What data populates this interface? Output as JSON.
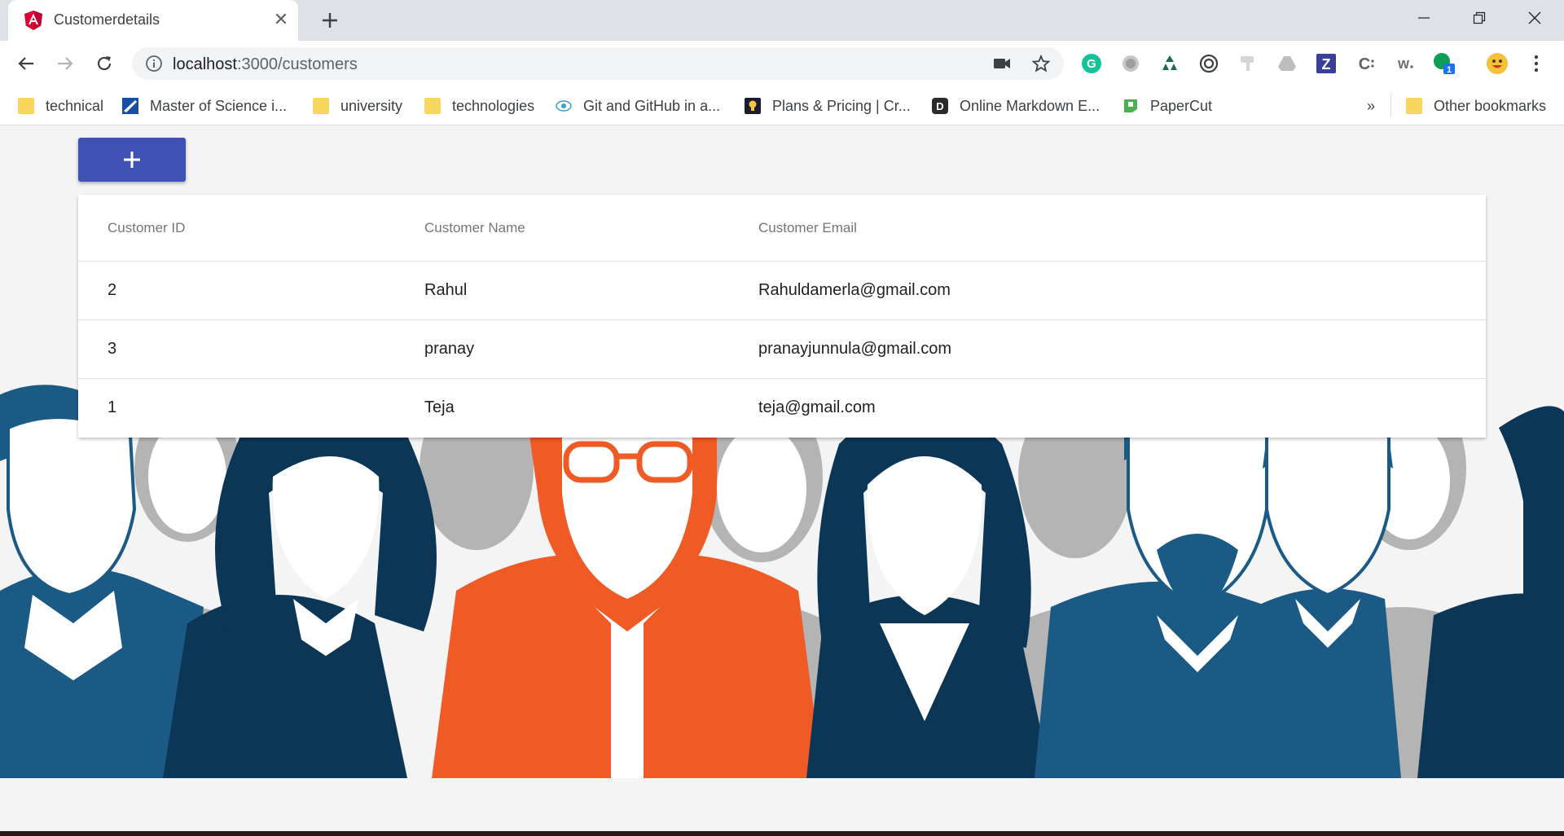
{
  "browser": {
    "tab_title": "Customerdetails",
    "url_host": "localhost",
    "url_path": ":3000/customers",
    "extension_badge": "1",
    "bookmarks": [
      {
        "label": "technical",
        "icon": "folder-icon"
      },
      {
        "label": "Master of Science i...",
        "icon": "university-logo-icon"
      },
      {
        "label": "university",
        "icon": "folder-icon"
      },
      {
        "label": "technologies",
        "icon": "folder-icon"
      },
      {
        "label": "Git and GitHub in a...",
        "icon": "eye-logo-icon"
      },
      {
        "label": "Plans & Pricing | Cr...",
        "icon": "lightbulb-icon"
      },
      {
        "label": "Online Markdown E...",
        "icon": "d-logo-icon"
      },
      {
        "label": "PaperCut",
        "icon": "papercut-icon"
      }
    ],
    "bookmarks_overflow": "»",
    "other_bookmarks": "Other bookmarks"
  },
  "page": {
    "add_button_label": "+",
    "table": {
      "headers": [
        "Customer ID",
        "Customer Name",
        "Customer Email"
      ],
      "rows": [
        [
          "2",
          "Rahul",
          "Rahuldamerla@gmail.com"
        ],
        [
          "3",
          "pranay",
          "pranayjunnula@gmail.com"
        ],
        [
          "1",
          "Teja",
          "teja@gmail.com"
        ]
      ]
    }
  },
  "colors": {
    "primary": "#3f51b5",
    "hero_dark": "#0c3656",
    "hero_mid": "#1c5a86",
    "hero_accent": "#f05a24",
    "hero_gray": "#b0b0b0"
  }
}
